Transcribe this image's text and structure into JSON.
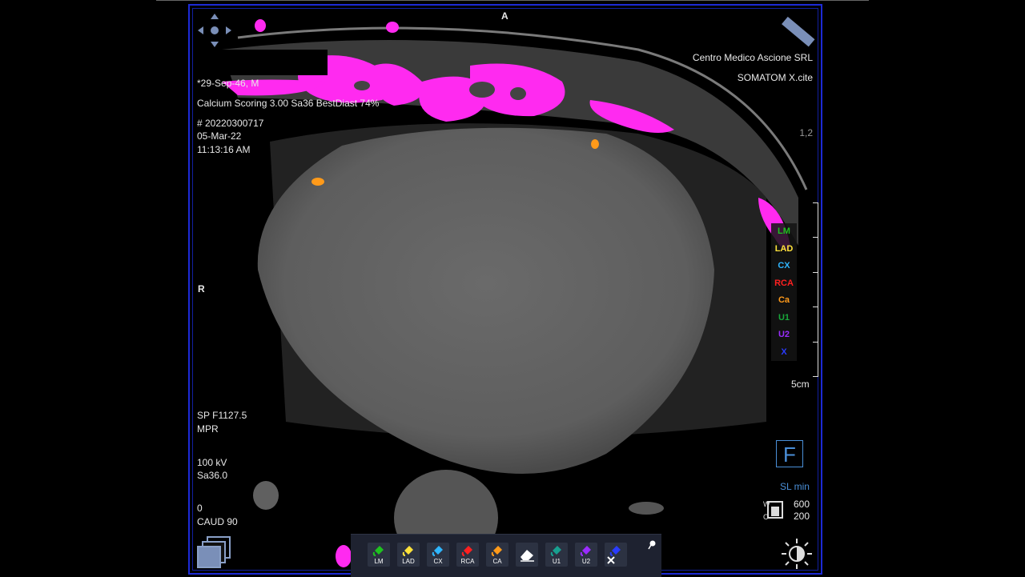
{
  "orientation": {
    "top": "A",
    "left": "R"
  },
  "patient": {
    "name_date": "*29-Sep-46, M",
    "protocol": "Calcium Scoring 3.00 Sa36 BestDiast 74%",
    "accession": "# 20220300717",
    "date": "05-Mar-22",
    "time": "11:13:16 AM"
  },
  "institution": {
    "name": "Centro Medico Ascione SRL",
    "scanner": "SOMATOM X.cite"
  },
  "zoom_label": "1,2",
  "scale_label": "5cm",
  "series_info": {
    "position": "SP F1127.5",
    "mode": "MPR",
    "kv": "100 kV",
    "kernel": "Sa36.0",
    "tilt": "0",
    "angle": "CAUD 90"
  },
  "f_indicator": "F",
  "slice_mode": "SL min",
  "window": {
    "w": "600",
    "c": "200"
  },
  "legend": [
    {
      "label": "LM",
      "color": "#1fc21f"
    },
    {
      "label": "LAD",
      "color": "#ffe23a"
    },
    {
      "label": "CX",
      "color": "#2fb6ff"
    },
    {
      "label": "RCA",
      "color": "#ff2020"
    },
    {
      "label": "Ca",
      "color": "#ff9a1a"
    },
    {
      "label": "U1",
      "color": "#18a83a"
    },
    {
      "label": "U2",
      "color": "#9a2cff"
    },
    {
      "label": "X",
      "color": "#2a3cff"
    }
  ],
  "toolbar": [
    {
      "label": "LM",
      "color": "#1fc21f",
      "name": "paint-lm-button"
    },
    {
      "label": "LAD",
      "color": "#ffe23a",
      "name": "paint-lad-button"
    },
    {
      "label": "CX",
      "color": "#2fb6ff",
      "name": "paint-cx-button"
    },
    {
      "label": "RCA",
      "color": "#ff2020",
      "name": "paint-rca-button"
    },
    {
      "label": "CA",
      "color": "#ff9a1a",
      "name": "paint-ca-button"
    },
    {
      "label": "",
      "color": "#ffffff",
      "name": "eraser-button"
    },
    {
      "label": "U1",
      "color": "#18a090",
      "name": "paint-u1-button"
    },
    {
      "label": "U2",
      "color": "#9a2cff",
      "name": "paint-u2-button"
    },
    {
      "label": "",
      "color": "#2a3cff",
      "name": "paint-x-button"
    }
  ]
}
